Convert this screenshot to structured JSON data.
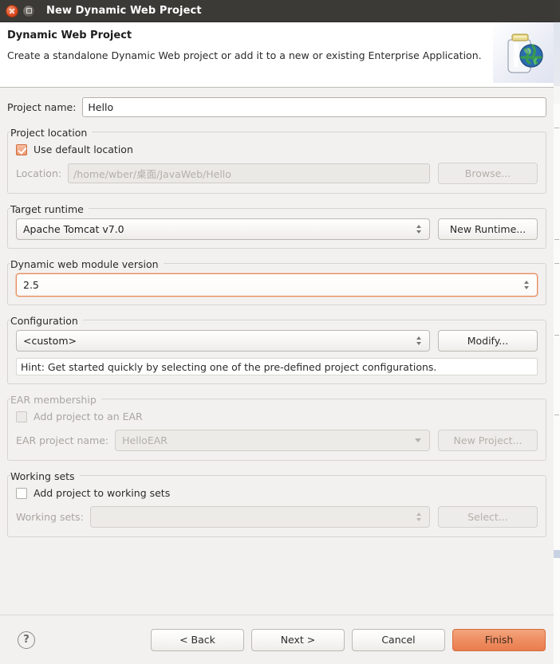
{
  "window": {
    "title": "New Dynamic Web Project",
    "close_icon": "close-icon",
    "maximize_icon": "maximize-icon"
  },
  "banner": {
    "title": "Dynamic Web Project",
    "description": "Create a standalone Dynamic Web project or add it to a new or existing Enterprise Application.",
    "image_icon": "web-project-jar-globe-icon"
  },
  "project_name": {
    "label": "Project name:",
    "value": "Hello",
    "placeholder": ""
  },
  "project_location": {
    "group_label": "Project location",
    "use_default_label": "Use default location",
    "use_default_checked": true,
    "location_label": "Location:",
    "location_value": "/home/wber/桌面/JavaWeb/Hello",
    "browse_label": "Browse..."
  },
  "target_runtime": {
    "group_label": "Target runtime",
    "selected": "Apache Tomcat v7.0",
    "new_runtime_label": "New Runtime..."
  },
  "module_version": {
    "group_label": "Dynamic web module version",
    "selected": "2.5"
  },
  "configuration": {
    "group_label": "Configuration",
    "selected": "<custom>",
    "modify_label": "Modify...",
    "hint": "Hint: Get started quickly by selecting one of the pre-defined project configurations."
  },
  "ear_membership": {
    "group_label": "EAR membership",
    "add_to_ear_label": "Add project to an EAR",
    "add_to_ear_checked": false,
    "ear_project_name_label": "EAR project name:",
    "ear_project_name_value": "HelloEAR",
    "new_project_label": "New Project..."
  },
  "working_sets": {
    "group_label": "Working sets",
    "add_to_working_sets_label": "Add project to working sets",
    "add_to_working_sets_checked": false,
    "working_sets_label": "Working sets:",
    "working_sets_value": "",
    "select_label": "Select..."
  },
  "buttons": {
    "help_glyph": "?",
    "back": "< Back",
    "next": "Next >",
    "cancel": "Cancel",
    "finish": "Finish"
  },
  "colors": {
    "accent_orange": "#ef8e63",
    "titlebar": "#3c3a37",
    "dialog_bg": "#f2f1f0",
    "focus_border": "#e8895a"
  }
}
